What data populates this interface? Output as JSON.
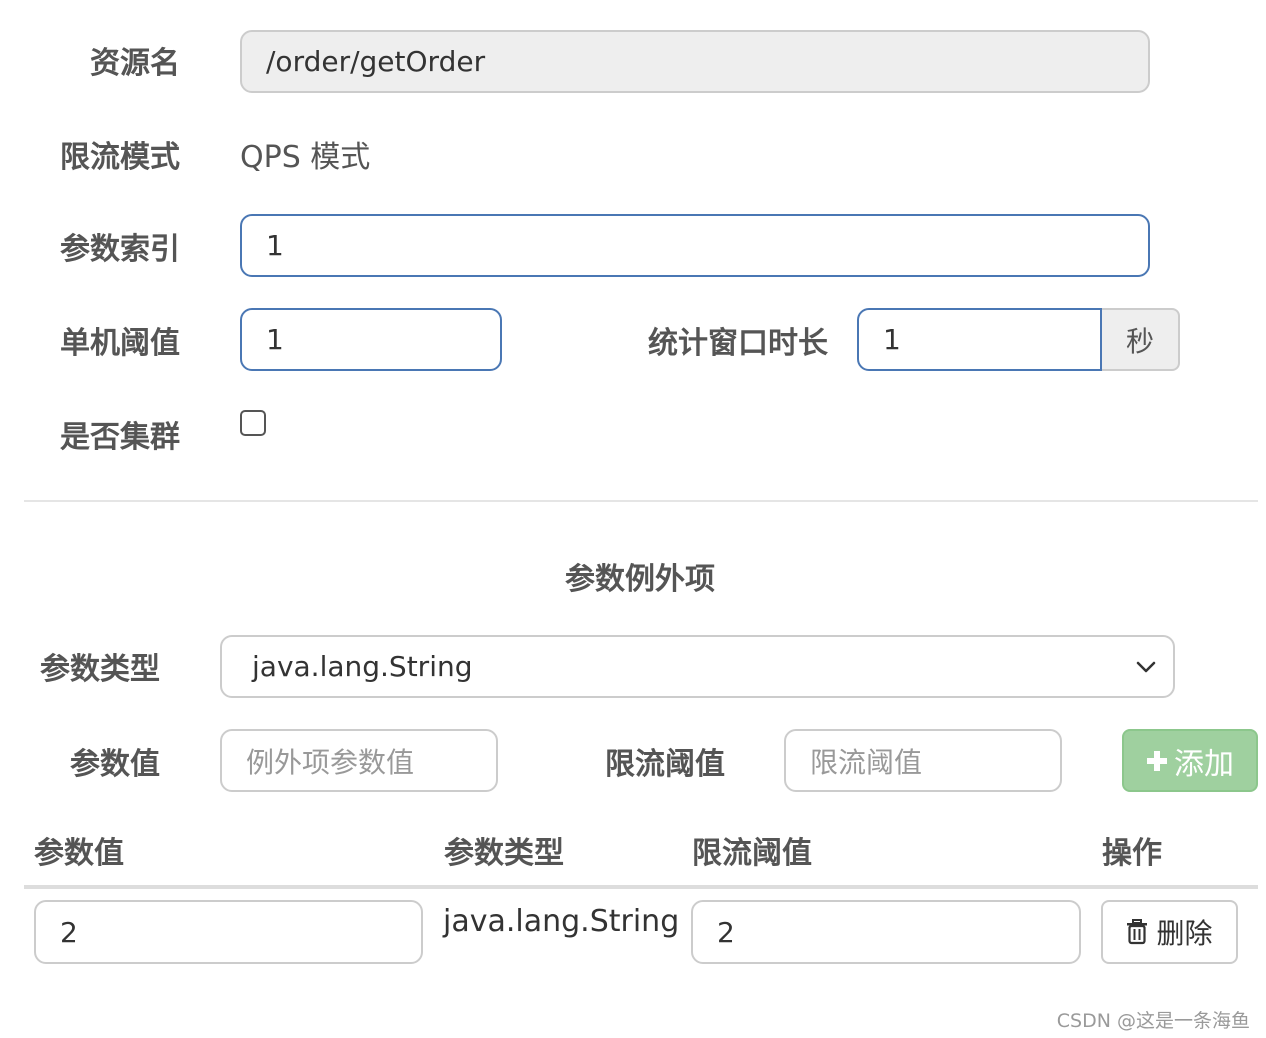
{
  "form": {
    "resource_label": "资源名",
    "resource_value": "/order/getOrder",
    "mode_label": "限流模式",
    "mode_value": "QPS 模式",
    "param_index_label": "参数索引",
    "param_index_value": "1",
    "threshold_label": "单机阈值",
    "threshold_value": "1",
    "window_label": "统计窗口时长",
    "window_value": "1",
    "window_unit": "秒",
    "cluster_label": "是否集群",
    "cluster_checked": false
  },
  "exceptions": {
    "title": "参数例外项",
    "type_label": "参数类型",
    "type_selected": "java.lang.String",
    "value_label": "参数值",
    "value_placeholder": "例外项参数值",
    "limit_label": "限流阈值",
    "limit_placeholder": "限流阈值",
    "add_label": "添加",
    "add_icon": "plus-icon",
    "table": {
      "headers": [
        "参数值",
        "参数类型",
        "限流阈值",
        "操作"
      ],
      "rows": [
        {
          "value": "2",
          "type": "java.lang.String",
          "limit": "2",
          "delete_label": "删除",
          "delete_icon": "trash-icon"
        }
      ]
    }
  },
  "watermark": "CSDN @这是一条海鱼",
  "colors": {
    "label": "#555555",
    "focus_border": "#4a77b4",
    "add_button": "#9fd09f",
    "readonly_bg": "#eeeeee"
  }
}
